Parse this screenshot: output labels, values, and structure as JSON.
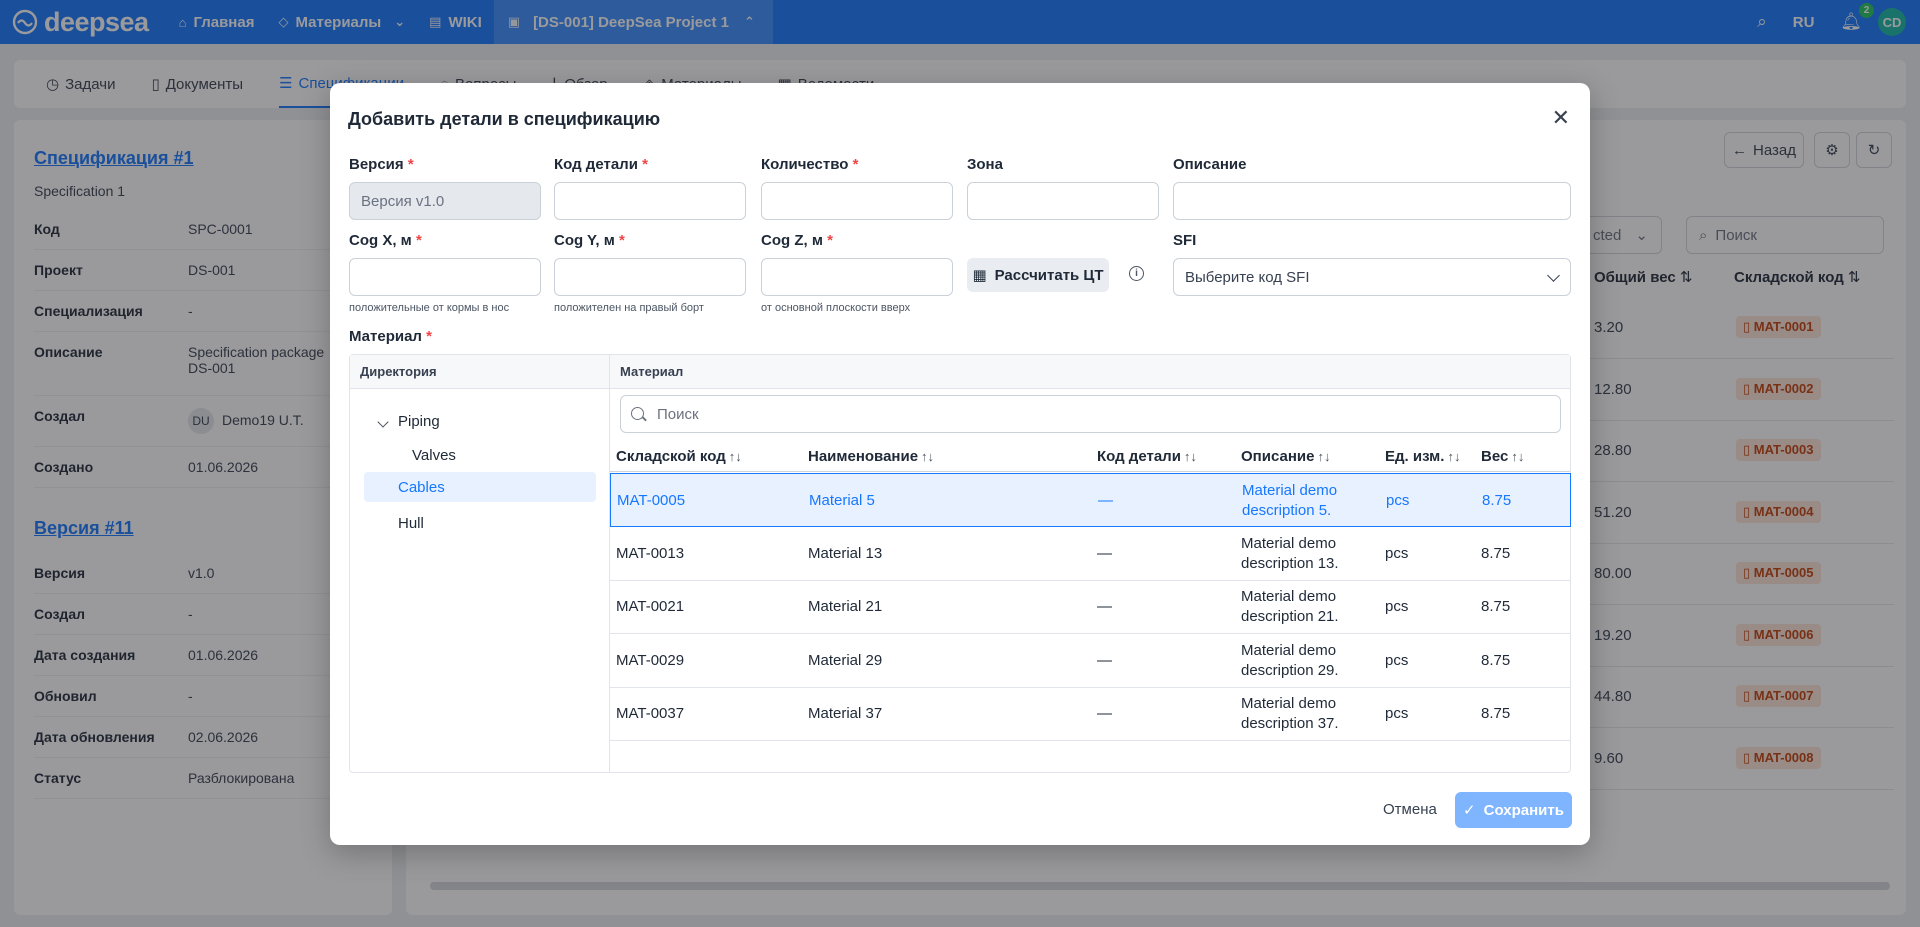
{
  "nav": {
    "logo": "deepsea",
    "items": [
      {
        "label": "Главная",
        "icon": "home-icon"
      },
      {
        "label": "Материалы",
        "icon": "tag-icon"
      },
      {
        "label": "WIKI",
        "icon": "book-icon"
      },
      {
        "label": "[DS-001] DeepSea Project 1",
        "icon": "briefcase-icon"
      }
    ],
    "lang": "RU",
    "notifications": "2",
    "avatar": "CD"
  },
  "subtabs": [
    "Задачи",
    "Документы",
    "Спецификации",
    "Вопросы",
    "Обзор",
    "Материалы",
    "Ведомости"
  ],
  "left_panel": {
    "spec_link": "Спецификация #1",
    "spec_name": "Specification 1",
    "rows": [
      {
        "k": "Код",
        "v": "SPC-0001"
      },
      {
        "k": "Проект",
        "v": "DS-001"
      },
      {
        "k": "Специализация",
        "v": "-"
      },
      {
        "k": "Описание",
        "v": "Specification package DS-001"
      },
      {
        "k": "Создал",
        "v": "Demo19 U.T.",
        "avatar": "DU"
      },
      {
        "k": "Создано",
        "v": "01.06.2026"
      }
    ],
    "version_link": "Версия #11",
    "version_rows": [
      {
        "k": "Версия",
        "v": "v1.0"
      },
      {
        "k": "Создал",
        "v": "-"
      },
      {
        "k": "Дата создания",
        "v": "01.06.2026"
      },
      {
        "k": "Обновил",
        "v": "-"
      },
      {
        "k": "Дата обновления",
        "v": "02.06.2026"
      },
      {
        "k": "Статус",
        "v": "Разблокирована"
      }
    ]
  },
  "right_panel": {
    "back": "Назад",
    "select_value": "cted",
    "search_placeholder": "Поиск",
    "col_weight": "Общий вес",
    "col_code": "Складской код",
    "rows": [
      {
        "w": "3.20",
        "code": "MAT-0001"
      },
      {
        "w": "12.80",
        "code": "MAT-0002"
      },
      {
        "w": "28.80",
        "code": "MAT-0003"
      },
      {
        "w": "51.20",
        "code": "MAT-0004"
      },
      {
        "w": "80.00",
        "code": "MAT-0005"
      },
      {
        "w": "19.20",
        "code": "MAT-0006"
      },
      {
        "w": "44.80",
        "code": "MAT-0007"
      },
      {
        "w": "9.60",
        "code": "MAT-0008"
      }
    ]
  },
  "modal": {
    "title": "Добавить детали в спецификацию",
    "fields": {
      "version_label": "Версия",
      "version_value": "Версия v1.0",
      "part_code_label": "Код детали",
      "qty_label": "Количество",
      "zone_label": "Зона",
      "desc_label": "Описание",
      "cogx_label": "Cog X, м",
      "cogy_label": "Cog Y, м",
      "cogz_label": "Cog Z, м",
      "cogx_hint": "положительные от кормы в нос",
      "cogy_hint": "положителен на правый борт",
      "cogz_hint": "от основной плоскости вверх",
      "calc_label": "Рассчитать ЦТ",
      "sfi_label": "SFI",
      "sfi_placeholder": "Выберите код SFI",
      "material_label": "Материал"
    },
    "dir_header": "Директория",
    "mat_header": "Материал",
    "tree": [
      {
        "label": "Piping",
        "level": 0
      },
      {
        "label": "Valves",
        "level": 1
      },
      {
        "label": "Cables",
        "level": 0
      },
      {
        "label": "Hull",
        "level": 0
      }
    ],
    "search_placeholder": "Поиск",
    "columns": [
      "Складской код",
      "Наименование",
      "Код детали",
      "Описание",
      "Ед. изм.",
      "Вес"
    ],
    "rows": [
      {
        "code": "MAT-0005",
        "name": "Material 5",
        "part": "—",
        "desc1": "Material demo",
        "desc2": "description 5.",
        "unit": "pcs",
        "weight": "8.75"
      },
      {
        "code": "MAT-0013",
        "name": "Material 13",
        "part": "—",
        "desc1": "Material demo",
        "desc2": "description 13.",
        "unit": "pcs",
        "weight": "8.75"
      },
      {
        "code": "MAT-0021",
        "name": "Material 21",
        "part": "—",
        "desc1": "Material demo",
        "desc2": "description 21.",
        "unit": "pcs",
        "weight": "8.75"
      },
      {
        "code": "MAT-0029",
        "name": "Material 29",
        "part": "—",
        "desc1": "Material demo",
        "desc2": "description 29.",
        "unit": "pcs",
        "weight": "8.75"
      },
      {
        "code": "MAT-0037",
        "name": "Material 37",
        "part": "—",
        "desc1": "Material demo",
        "desc2": "description 37.",
        "unit": "pcs",
        "weight": "8.75"
      }
    ],
    "cancel": "Отмена",
    "save": "Сохранить"
  }
}
